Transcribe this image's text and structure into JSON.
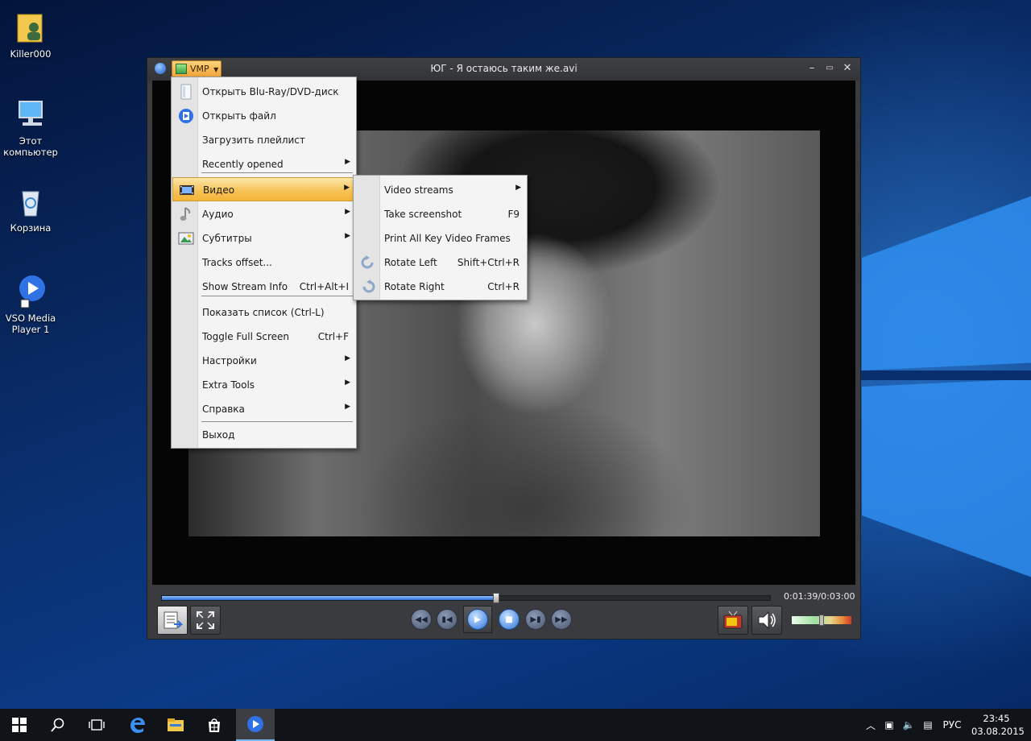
{
  "desktop": {
    "icons": [
      {
        "label": "Killer000"
      },
      {
        "label": "Этот\nкомпьютер"
      },
      {
        "label": "Корзина"
      },
      {
        "label": "VSO Media\nPlayer 1"
      }
    ]
  },
  "player": {
    "title": "ЮГ - Я остаюсь таким же.avi",
    "menu_button": "VMP",
    "timecode": "0:01:39/0:03:00",
    "progress": 0.55,
    "volume": 0.5
  },
  "main_menu": {
    "items": [
      {
        "label": "Открыть Blu-Ray/DVD-диск",
        "shortcut": "",
        "submenu": false
      },
      {
        "label": "Открыть файл",
        "shortcut": "",
        "submenu": false
      },
      {
        "label": "Загрузить плейлист",
        "shortcut": "",
        "submenu": false
      },
      {
        "label": "Recently opened",
        "shortcut": "",
        "submenu": true
      },
      {
        "label": "Видео",
        "shortcut": "",
        "submenu": true
      },
      {
        "label": "Аудио",
        "shortcut": "",
        "submenu": true
      },
      {
        "label": "Субтитры",
        "shortcut": "",
        "submenu": true
      },
      {
        "label": "Tracks offset...",
        "shortcut": "",
        "submenu": false
      },
      {
        "label": "Show Stream Info",
        "shortcut": "Ctrl+Alt+I",
        "submenu": false
      },
      {
        "label": "Показать список (Ctrl-L)",
        "shortcut": "",
        "submenu": false
      },
      {
        "label": "Toggle Full Screen",
        "shortcut": "Ctrl+F",
        "submenu": false
      },
      {
        "label": "Настройки",
        "shortcut": "",
        "submenu": true
      },
      {
        "label": "Extra Tools",
        "shortcut": "",
        "submenu": true
      },
      {
        "label": "Справка",
        "shortcut": "",
        "submenu": true
      },
      {
        "label": "Выход",
        "shortcut": "",
        "submenu": false
      }
    ]
  },
  "video_submenu": {
    "items": [
      {
        "label": "Video streams",
        "shortcut": "",
        "submenu": true
      },
      {
        "label": "Take screenshot",
        "shortcut": "F9",
        "submenu": false
      },
      {
        "label": "Print All Key Video Frames",
        "shortcut": "",
        "submenu": false
      },
      {
        "label": "Rotate Left",
        "shortcut": "Shift+Ctrl+R",
        "submenu": false
      },
      {
        "label": "Rotate Right",
        "shortcut": "Ctrl+R",
        "submenu": false
      }
    ]
  },
  "taskbar": {
    "language": "РУС",
    "time": "23:45",
    "date": "03.08.2015"
  },
  "colors": {
    "accent": "#2d6fd6",
    "menu_highlight": "#f7c45a",
    "taskbar": "#101418"
  }
}
